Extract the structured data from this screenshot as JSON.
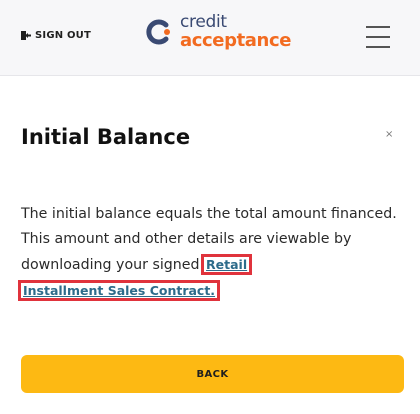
{
  "header": {
    "signout_label": "SIGN OUT",
    "signout_icon": "sign-out-icon",
    "logo_top": "credit",
    "logo_bottom": "acceptance",
    "menu_icon": "hamburger-menu-icon"
  },
  "dialog": {
    "title": "Initial Balance",
    "close_label": "×",
    "body_text": "The initial balance equals the total amount financed. This amount and other details are viewable by downloading your signed ",
    "link_part1": "Retail",
    "link_part2": "Installment Sales Contract.",
    "back_label": "BACK"
  },
  "colors": {
    "brand_orange": "#f26b21",
    "brand_navy": "#3a4a73",
    "button_yellow": "#fdb913",
    "link_teal": "#2d6b8a",
    "highlight_red": "#e0333c"
  }
}
